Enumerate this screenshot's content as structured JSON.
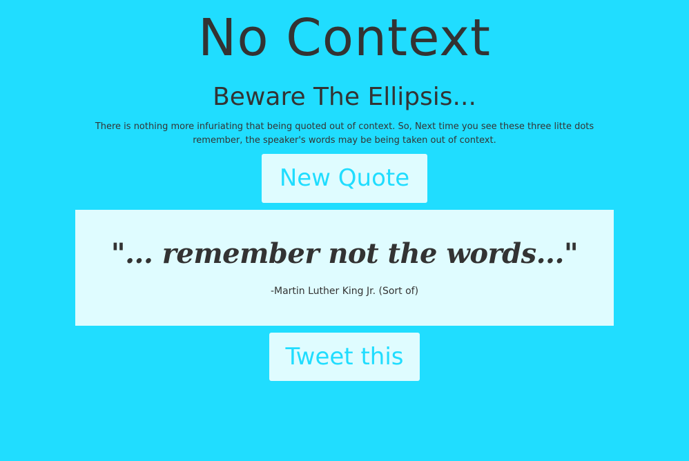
{
  "page": {
    "title": "No Context",
    "subtitle": "Beware The Ellipsis...",
    "description": "There is nothing more infuriating that being quoted out of context. So, Next time you see these three litte dots remember, the speaker's words may be being taken out of context."
  },
  "buttons": {
    "new_quote_label": "New Quote",
    "tweet_label": "Tweet this"
  },
  "quote": {
    "text": "\"... remember not the words...\"",
    "author": "-Martin Luther King Jr. (Sort of)"
  },
  "colors": {
    "background": "#20ddff",
    "panel": "#dffcff",
    "text": "#333333",
    "button_text": "#20ddff"
  }
}
